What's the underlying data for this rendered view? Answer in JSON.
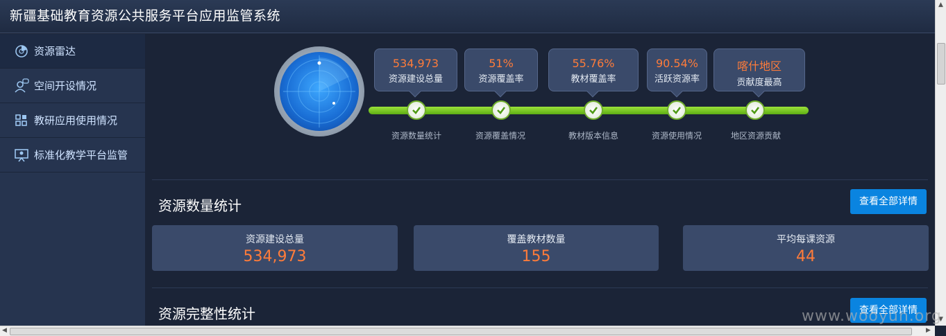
{
  "header": {
    "title": "新疆基础教育资源公共服务平台应用监管系统"
  },
  "sidebar": {
    "items": [
      {
        "label": "资源雷达",
        "icon": "radar-icon",
        "active": true
      },
      {
        "label": "空间开设情况",
        "icon": "user-chat-icon"
      },
      {
        "label": "教研应用使用情况",
        "icon": "grid-apps-icon"
      },
      {
        "label": "标准化教学平台监管",
        "icon": "presentation-board-icon"
      }
    ]
  },
  "radar": {
    "icon": "radar-scope-icon"
  },
  "metrics": [
    {
      "value": "534,973",
      "label": "资源建设总量"
    },
    {
      "value": "51%",
      "label": "资源覆盖率"
    },
    {
      "value": "55.76%",
      "label": "教材覆盖率"
    },
    {
      "value": "90.54%",
      "label": "活跃资源率"
    },
    {
      "value": "喀什地区",
      "label": "贡献度最高"
    }
  ],
  "timeline": {
    "steps": [
      {
        "label": "资源数量统计",
        "icon": "check-circle-icon"
      },
      {
        "label": "资源覆盖情况",
        "icon": "check-circle-icon"
      },
      {
        "label": "教材版本信息",
        "icon": "check-circle-icon"
      },
      {
        "label": "资源使用情况",
        "icon": "check-circle-icon"
      },
      {
        "label": "地区资源贡献",
        "icon": "check-circle-icon"
      }
    ]
  },
  "section_quantity": {
    "title": "资源数量统计",
    "button_label": "查看全部详情",
    "cards": [
      {
        "label": "资源建设总量",
        "value": "534,973"
      },
      {
        "label": "覆盖教材数量",
        "value": "155"
      },
      {
        "label": "平均每课资源",
        "value": "44"
      }
    ]
  },
  "section_integrity": {
    "title": "资源完整性统计",
    "button_label": "查看全部详情"
  },
  "watermark": "www.wooyun.org",
  "colors": {
    "accent_orange": "#ff7c3a",
    "button_blue": "#0a84e0",
    "progress_green": "#7ccc24"
  }
}
